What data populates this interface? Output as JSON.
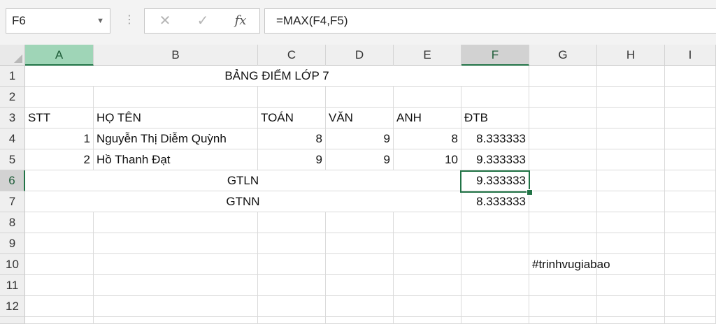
{
  "formula_bar": {
    "name_box": "F6",
    "cancel_glyph": "✕",
    "enter_glyph": "✓",
    "fx_label": "fx",
    "formula": "=MAX(F4,F5)"
  },
  "columns": [
    "A",
    "B",
    "C",
    "D",
    "E",
    "F",
    "G",
    "H",
    "I"
  ],
  "rows": [
    "1",
    "2",
    "3",
    "4",
    "5",
    "6",
    "7",
    "8",
    "9",
    "10",
    "11",
    "12"
  ],
  "selected_cell": "F6",
  "sheet": {
    "title": "BẢNG ĐIỂM LỚP 7",
    "headers": [
      "STT",
      "HỌ TÊN",
      "TOÁN",
      "VĂN",
      "ANH",
      "ĐTB"
    ],
    "students": [
      {
        "stt": "1",
        "name": "Nguyễn Thị Diễm Quỳnh",
        "toan": "8",
        "van": "9",
        "anh": "8",
        "dtb": "8.333333"
      },
      {
        "stt": "2",
        "name": "Hồ Thanh Đạt",
        "toan": "9",
        "van": "9",
        "anh": "10",
        "dtb": "9.333333"
      }
    ],
    "max_label": "GTLN",
    "max_value": "9.333333",
    "min_label": "GTNN",
    "min_value": "8.333333",
    "watermark": "#trinhvugiabao"
  },
  "colors": {
    "accent": "#217346",
    "selected_header": "#9fd5b7"
  }
}
